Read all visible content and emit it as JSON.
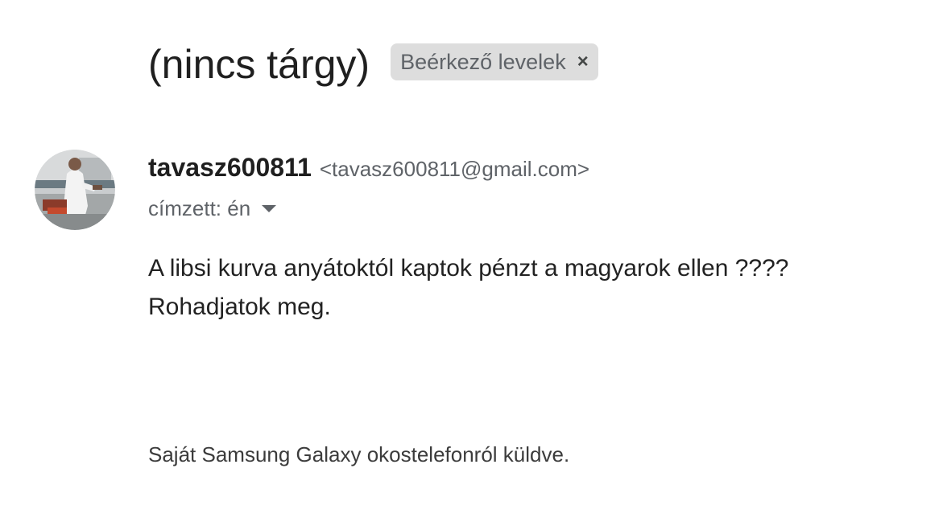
{
  "email": {
    "subject": "(nincs tárgy)",
    "label": {
      "text": "Beérkező levelek",
      "remove_symbol": "×"
    },
    "sender": {
      "name": "tavasz600811",
      "email": "<tavasz600811@gmail.com>",
      "avatar_icon": "user-photo-avatar"
    },
    "recipient": {
      "text": "címzett: én",
      "dropdown_icon": "caret-down-icon"
    },
    "body_lines": [
      "A libsi kurva anyátoktól kaptok pénzt a magyarok ellen ????",
      "Rohadjatok meg."
    ],
    "signature": "Saját Samsung Galaxy okostelefonról küldve."
  },
  "colors": {
    "chip_background": "#dddddd",
    "secondary_text": "#5f6368",
    "primary_text": "#1f1f1f"
  }
}
